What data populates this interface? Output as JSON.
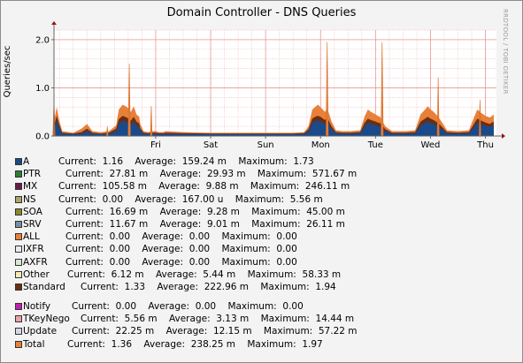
{
  "title": "Domain Controller - DNS Queries",
  "watermark": "RRDTOOL / TOBI OETIKER",
  "chart_data": {
    "type": "area",
    "title": "Domain Controller - DNS Queries",
    "ylabel": "Queries/sec",
    "xlabel": "",
    "ylim": [
      0,
      2.2
    ],
    "y_ticks": [
      {
        "value": 0.0,
        "label": "0.0"
      },
      {
        "value": 1.0,
        "label": "1.0"
      },
      {
        "value": 2.0,
        "label": "2.0"
      }
    ],
    "x_ticks": [
      {
        "t": 1.0,
        "label": "Fri"
      },
      {
        "t": 2.0,
        "label": "Sat"
      },
      {
        "t": 3.0,
        "label": "Sun"
      },
      {
        "t": 4.0,
        "label": "Mon"
      },
      {
        "t": 5.0,
        "label": "Tue"
      },
      {
        "t": 6.0,
        "label": "Wed"
      },
      {
        "t": 7.0,
        "label": "Thu"
      }
    ],
    "x_range": [
      -0.85,
      7.2
    ],
    "grid": true,
    "series": [
      {
        "name": "Total",
        "color": "#e8803a",
        "points": [
          [
            -0.85,
            0.3
          ],
          [
            -0.8,
            0.6
          ],
          [
            -0.76,
            0.35
          ],
          [
            -0.7,
            0.1
          ],
          [
            -0.5,
            0.07
          ],
          [
            -0.35,
            0.15
          ],
          [
            -0.25,
            0.25
          ],
          [
            -0.15,
            0.1
          ],
          [
            0.0,
            0.08
          ],
          [
            0.15,
            0.1
          ],
          [
            0.28,
            0.22
          ],
          [
            0.33,
            0.55
          ],
          [
            0.4,
            0.65
          ],
          [
            0.48,
            0.6
          ],
          [
            0.55,
            0.5
          ],
          [
            0.6,
            0.62
          ],
          [
            0.65,
            0.45
          ],
          [
            0.7,
            0.4
          ],
          [
            0.72,
            0.25
          ],
          [
            0.78,
            0.1
          ],
          [
            0.86,
            0.08
          ],
          [
            0.94,
            0.1
          ],
          [
            1.0,
            0.1
          ],
          [
            1.06,
            0.08
          ],
          [
            1.14,
            0.08
          ],
          [
            1.18,
            0.1
          ],
          [
            1.5,
            0.08
          ],
          [
            2.0,
            0.07
          ],
          [
            2.5,
            0.07
          ],
          [
            3.0,
            0.07
          ],
          [
            3.5,
            0.07
          ],
          [
            3.7,
            0.08
          ],
          [
            3.78,
            0.2
          ],
          [
            3.85,
            0.55
          ],
          [
            3.9,
            0.6
          ],
          [
            3.95,
            0.65
          ],
          [
            4.0,
            0.6
          ],
          [
            4.08,
            0.5
          ],
          [
            4.12,
            0.58
          ],
          [
            4.2,
            0.3
          ],
          [
            4.28,
            0.12
          ],
          [
            4.4,
            0.1
          ],
          [
            4.55,
            0.1
          ],
          [
            4.72,
            0.12
          ],
          [
            4.8,
            0.4
          ],
          [
            4.86,
            0.55
          ],
          [
            4.92,
            0.5
          ],
          [
            5.0,
            0.45
          ],
          [
            5.04,
            0.42
          ],
          [
            5.08,
            0.4
          ],
          [
            5.18,
            0.2
          ],
          [
            5.3,
            0.1
          ],
          [
            5.55,
            0.1
          ],
          [
            5.72,
            0.12
          ],
          [
            5.82,
            0.45
          ],
          [
            5.9,
            0.55
          ],
          [
            5.95,
            0.62
          ],
          [
            6.0,
            0.55
          ],
          [
            6.06,
            0.5
          ],
          [
            6.14,
            0.4
          ],
          [
            6.2,
            0.3
          ],
          [
            6.3,
            0.12
          ],
          [
            6.5,
            0.1
          ],
          [
            6.7,
            0.12
          ],
          [
            6.78,
            0.35
          ],
          [
            6.85,
            0.55
          ],
          [
            6.92,
            0.48
          ],
          [
            7.0,
            0.42
          ],
          [
            7.08,
            0.38
          ],
          [
            7.12,
            0.42
          ],
          [
            7.15,
            0.45
          ]
        ]
      },
      {
        "name": "Standard",
        "color": "#6b2e10",
        "points": [
          [
            -0.85,
            0.2
          ],
          [
            -0.8,
            0.42
          ],
          [
            -0.76,
            0.25
          ],
          [
            -0.7,
            0.07
          ],
          [
            -0.5,
            0.05
          ],
          [
            -0.35,
            0.08
          ],
          [
            -0.25,
            0.15
          ],
          [
            -0.15,
            0.07
          ],
          [
            0.0,
            0.05
          ],
          [
            0.15,
            0.07
          ],
          [
            0.28,
            0.15
          ],
          [
            0.33,
            0.35
          ],
          [
            0.4,
            0.42
          ],
          [
            0.48,
            0.38
          ],
          [
            0.55,
            0.32
          ],
          [
            0.6,
            0.4
          ],
          [
            0.65,
            0.3
          ],
          [
            0.7,
            0.26
          ],
          [
            0.72,
            0.16
          ],
          [
            0.78,
            0.07
          ],
          [
            0.86,
            0.06
          ],
          [
            0.94,
            0.07
          ],
          [
            1.0,
            0.07
          ],
          [
            1.06,
            0.06
          ],
          [
            1.14,
            0.06
          ],
          [
            1.18,
            0.07
          ],
          [
            1.5,
            0.06
          ],
          [
            2.0,
            0.05
          ],
          [
            2.5,
            0.05
          ],
          [
            3.0,
            0.05
          ],
          [
            3.5,
            0.05
          ],
          [
            3.7,
            0.06
          ],
          [
            3.78,
            0.14
          ],
          [
            3.85,
            0.36
          ],
          [
            3.9,
            0.4
          ],
          [
            3.95,
            0.42
          ],
          [
            4.0,
            0.4
          ],
          [
            4.08,
            0.33
          ],
          [
            4.12,
            0.38
          ],
          [
            4.2,
            0.2
          ],
          [
            4.28,
            0.08
          ],
          [
            4.4,
            0.07
          ],
          [
            4.55,
            0.07
          ],
          [
            4.72,
            0.08
          ],
          [
            4.8,
            0.27
          ],
          [
            4.86,
            0.36
          ],
          [
            4.92,
            0.33
          ],
          [
            5.0,
            0.3
          ],
          [
            5.04,
            0.28
          ],
          [
            5.08,
            0.27
          ],
          [
            5.18,
            0.14
          ],
          [
            5.3,
            0.07
          ],
          [
            5.55,
            0.07
          ],
          [
            5.72,
            0.08
          ],
          [
            5.82,
            0.3
          ],
          [
            5.9,
            0.36
          ],
          [
            5.95,
            0.4
          ],
          [
            6.0,
            0.36
          ],
          [
            6.06,
            0.33
          ],
          [
            6.14,
            0.27
          ],
          [
            6.2,
            0.2
          ],
          [
            6.3,
            0.08
          ],
          [
            6.5,
            0.07
          ],
          [
            6.7,
            0.08
          ],
          [
            6.78,
            0.23
          ],
          [
            6.85,
            0.36
          ],
          [
            6.92,
            0.32
          ],
          [
            7.0,
            0.28
          ],
          [
            7.08,
            0.25
          ],
          [
            7.12,
            0.28
          ],
          [
            7.15,
            0.3
          ]
        ]
      },
      {
        "name": "A",
        "color": "#1a4a8a",
        "points": [
          [
            -0.85,
            0.15
          ],
          [
            -0.8,
            0.32
          ],
          [
            -0.76,
            0.18
          ],
          [
            -0.7,
            0.05
          ],
          [
            -0.5,
            0.04
          ],
          [
            -0.35,
            0.05
          ],
          [
            -0.25,
            0.1
          ],
          [
            -0.15,
            0.05
          ],
          [
            0.0,
            0.04
          ],
          [
            0.15,
            0.05
          ],
          [
            0.28,
            0.1
          ],
          [
            0.33,
            0.26
          ],
          [
            0.4,
            0.32
          ],
          [
            0.48,
            0.28
          ],
          [
            0.55,
            0.24
          ],
          [
            0.6,
            0.3
          ],
          [
            0.65,
            0.22
          ],
          [
            0.7,
            0.19
          ],
          [
            0.72,
            0.12
          ],
          [
            0.78,
            0.05
          ],
          [
            0.86,
            0.04
          ],
          [
            0.94,
            0.05
          ],
          [
            1.0,
            0.05
          ],
          [
            1.06,
            0.04
          ],
          [
            1.14,
            0.04
          ],
          [
            1.18,
            0.05
          ],
          [
            1.5,
            0.04
          ],
          [
            2.0,
            0.04
          ],
          [
            2.5,
            0.04
          ],
          [
            3.0,
            0.04
          ],
          [
            3.5,
            0.04
          ],
          [
            3.7,
            0.04
          ],
          [
            3.78,
            0.1
          ],
          [
            3.85,
            0.27
          ],
          [
            3.9,
            0.3
          ],
          [
            3.95,
            0.32
          ],
          [
            4.0,
            0.3
          ],
          [
            4.08,
            0.25
          ],
          [
            4.12,
            0.29
          ],
          [
            4.2,
            0.15
          ],
          [
            4.28,
            0.06
          ],
          [
            4.4,
            0.05
          ],
          [
            4.55,
            0.05
          ],
          [
            4.72,
            0.06
          ],
          [
            4.8,
            0.2
          ],
          [
            4.86,
            0.27
          ],
          [
            4.92,
            0.25
          ],
          [
            5.0,
            0.22
          ],
          [
            5.04,
            0.21
          ],
          [
            5.08,
            0.2
          ],
          [
            5.18,
            0.1
          ],
          [
            5.3,
            0.05
          ],
          [
            5.55,
            0.05
          ],
          [
            5.72,
            0.06
          ],
          [
            5.82,
            0.22
          ],
          [
            5.9,
            0.27
          ],
          [
            5.95,
            0.3
          ],
          [
            6.0,
            0.27
          ],
          [
            6.06,
            0.25
          ],
          [
            6.14,
            0.2
          ],
          [
            6.2,
            0.15
          ],
          [
            6.3,
            0.06
          ],
          [
            6.5,
            0.05
          ],
          [
            6.7,
            0.06
          ],
          [
            6.78,
            0.17
          ],
          [
            6.85,
            0.27
          ],
          [
            6.92,
            0.24
          ],
          [
            7.0,
            0.21
          ],
          [
            7.08,
            0.19
          ],
          [
            7.12,
            0.21
          ],
          [
            7.15,
            0.22
          ]
        ]
      }
    ],
    "spikes": [
      {
        "t": -0.85,
        "value": 0.75,
        "width": 0.04
      },
      {
        "t": 0.12,
        "value": 0.2,
        "width": 0.03
      },
      {
        "t": 0.52,
        "value": 1.5,
        "width": 0.04
      },
      {
        "t": 0.92,
        "value": 0.62,
        "width": 0.03
      },
      {
        "t": 4.12,
        "value": 1.95,
        "width": 0.04
      },
      {
        "t": 5.12,
        "value": 1.95,
        "width": 0.04
      },
      {
        "t": 6.14,
        "value": 1.22,
        "width": 0.035
      },
      {
        "t": 6.9,
        "value": 0.75,
        "width": 0.03
      }
    ]
  },
  "legend": [
    {
      "name": "A",
      "color": "#1a4a8a",
      "current": "1.16",
      "average": "159.24 m",
      "maximum": "1.73"
    },
    {
      "name": "PTR",
      "color": "#2e7d32",
      "current": "27.81 m",
      "average": "29.93 m",
      "maximum": "571.67 m"
    },
    {
      "name": "MX",
      "color": "#6a1b4d",
      "current": "105.58 m",
      "average": "9.88 m",
      "maximum": "246.11 m"
    },
    {
      "name": "NS",
      "color": "#b0a46a",
      "current": "0.00",
      "average": "167.00 u",
      "maximum": "5.56 m"
    },
    {
      "name": "SOA",
      "color": "#8a8a2a",
      "current": "16.69 m",
      "average": "9.28 m",
      "maximum": "45.00 m"
    },
    {
      "name": "SRV",
      "color": "#7a8fa0",
      "current": "11.67 m",
      "average": "9.01 m",
      "maximum": "26.11 m"
    },
    {
      "name": "ALL",
      "color": "#e8803a",
      "current": "0.00",
      "average": "0.00",
      "maximum": "0.00"
    },
    {
      "name": "IXFR",
      "color": "#e8e8f0",
      "current": "0.00",
      "average": "0.00",
      "maximum": "0.00"
    },
    {
      "name": "AXFR",
      "color": "#d8e8d0",
      "current": "0.00",
      "average": "0.00",
      "maximum": "0.00"
    },
    {
      "name": "Other",
      "color": "#f8e8b0",
      "current": "6.12 m",
      "average": "5.44 m",
      "maximum": "58.33 m"
    },
    {
      "name": "Standard",
      "color": "#6b2e10",
      "current": "1.33",
      "average": "222.96 m",
      "maximum": "1.94"
    },
    {
      "name": "Notify",
      "color": "#c21fb0",
      "current": "0.00",
      "average": "0.00",
      "maximum": "0.00"
    },
    {
      "name": "TKeyNego",
      "color": "#f0a0a8",
      "current": "5.56 m",
      "average": "3.13 m",
      "maximum": "14.44 m"
    },
    {
      "name": "Update",
      "color": "#d8d8e8",
      "current": "22.25 m",
      "average": "12.15 m",
      "maximum": "57.22 m"
    },
    {
      "name": "Total",
      "color": "#e8803a",
      "current": "1.36",
      "average": "238.25 m",
      "maximum": "1.97"
    }
  ],
  "labels": {
    "current": "Current:",
    "average": "Average:",
    "maximum": "Maximum:"
  }
}
